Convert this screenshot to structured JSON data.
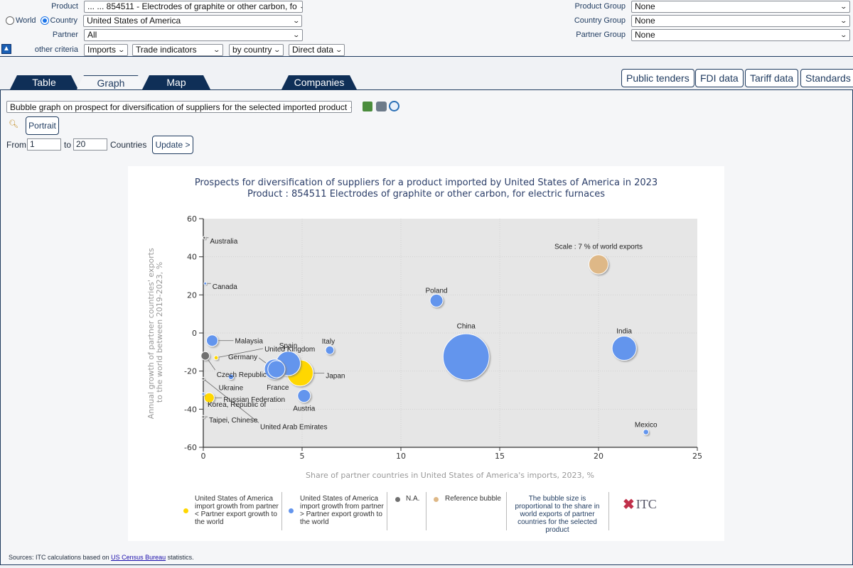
{
  "filters": {
    "product_label": "Product",
    "product_value": "... ... 854511 - Electrodes of graphite or other carbon, fo",
    "world_label": "World",
    "country_label": "Country",
    "reporter_mode": "Country",
    "country_value": "United States of America",
    "partner_label": "Partner",
    "partner_value": "All",
    "other_criteria_label": "other criteria",
    "trade_flow": "Imports",
    "indicator": "Trade indicators",
    "grouping": "by country",
    "data_type": "Direct data",
    "product_group_label": "Product Group",
    "product_group_value": "None",
    "country_group_label": "Country Group",
    "country_group_value": "None",
    "partner_group_label": "Partner Group",
    "partner_group_value": "None"
  },
  "tabs": [
    {
      "label": "Table",
      "active": false
    },
    {
      "label": "Graph",
      "active": true
    },
    {
      "label": "Map",
      "active": false
    },
    {
      "label": "Companies",
      "active": false
    }
  ],
  "right_buttons": [
    "Public tenders",
    "FDI data",
    "Tariff data",
    "Standards"
  ],
  "graph_controls": {
    "graph_type": "Bubble graph on prospect for diversification of suppliers for the selected imported product",
    "portrait_label": "Portrait",
    "from_label": "From",
    "from_value": "1",
    "to_label": "to",
    "to_value": "20",
    "countries_label": "Countries",
    "update_label": "Update >"
  },
  "chart_data": {
    "type": "scatter",
    "subtype": "bubble",
    "title": "Prospects for diversification of suppliers for a product imported by United States of America in 2023",
    "subtitle": "Product : 854511 Electrodes of graphite or other carbon, for electric furnaces",
    "xlabel": "Share of partner countries in United States of America's imports, 2023, %",
    "ylabel": "Annual growth of partner countries' exports to the world between 2019-2023, %",
    "xlim": [
      0,
      25
    ],
    "ylim": [
      -60,
      60
    ],
    "xticks": [
      0,
      5,
      10,
      15,
      20,
      25
    ],
    "yticks": [
      60,
      40,
      20,
      0,
      -20,
      -40,
      -60
    ],
    "grid": true,
    "colors": {
      "lower": "#ffd700",
      "higher": "#6495ed",
      "na": "#707070",
      "reference": "#deb887"
    },
    "points": [
      {
        "name": "Australia",
        "x": 0.05,
        "y": 50,
        "size": 0.1,
        "category": "na"
      },
      {
        "name": "Canada",
        "x": 0.1,
        "y": 26,
        "size": 0.1,
        "category": "higher"
      },
      {
        "name": "Malaysia",
        "x": 0.45,
        "y": -4,
        "size": 2.2,
        "category": "higher"
      },
      {
        "name": "United Kingdom",
        "x": 0.65,
        "y": -13,
        "size": 0.3,
        "category": "lower"
      },
      {
        "name": "Czech Republic",
        "x": 0.1,
        "y": -12,
        "size": 1.2,
        "category": "na"
      },
      {
        "name": "Germany",
        "x": 3.6,
        "y": -19,
        "size": 6.8,
        "category": "higher"
      },
      {
        "name": "France",
        "x": 3.7,
        "y": -19,
        "size": 5.0,
        "category": "higher"
      },
      {
        "name": "Spain",
        "x": 4.3,
        "y": -16,
        "size": 10.0,
        "category": "higher"
      },
      {
        "name": "Japan",
        "x": 4.9,
        "y": -21,
        "size": 11.5,
        "category": "lower"
      },
      {
        "name": "Italy",
        "x": 6.4,
        "y": -9,
        "size": 1.2,
        "category": "higher"
      },
      {
        "name": "Ukraine",
        "x": 1.4,
        "y": -23,
        "size": 0.5,
        "category": "higher"
      },
      {
        "name": "Austria",
        "x": 5.1,
        "y": -33,
        "size": 2.8,
        "category": "higher"
      },
      {
        "name": "Russian Federation",
        "x": 0.3,
        "y": -34,
        "size": 1.7,
        "category": "lower"
      },
      {
        "name": "Korea, Republic of",
        "x": 0.0,
        "y": -32,
        "size": 0.1,
        "category": "higher"
      },
      {
        "name": "United Arab Emirates",
        "x": 0.0,
        "y": -24,
        "size": 0.1,
        "category": "na"
      },
      {
        "name": "Taipei, Chinese",
        "x": 0.0,
        "y": -44,
        "size": 0.1,
        "category": "na"
      },
      {
        "name": "Poland",
        "x": 11.8,
        "y": 17,
        "size": 2.8,
        "category": "higher"
      },
      {
        "name": "China",
        "x": 13.3,
        "y": -12.5,
        "size": 36.0,
        "category": "higher"
      },
      {
        "name": "India",
        "x": 21.3,
        "y": -8,
        "size": 10.0,
        "category": "higher"
      },
      {
        "name": "Mexico",
        "x": 22.4,
        "y": -52,
        "size": 0.5,
        "category": "higher"
      }
    ],
    "reference_bubble": {
      "label": "Scale : 7 % of world exports",
      "x": 20,
      "y": 36,
      "size": 7
    },
    "legend": [
      {
        "text": "United States of America import growth from partner < Partner export growth to the world",
        "color": "#ffd700"
      },
      {
        "text": "United States of America import growth from partner > Partner export growth to the world",
        "color": "#6495ed"
      },
      {
        "text": "N.A.",
        "color": "#707070"
      },
      {
        "text": "Reference bubble",
        "color": "#deb887"
      },
      {
        "text": "The bubble size is proportional to the share in world exports of partner countries for the selected product",
        "color": ""
      }
    ],
    "logo": "ITC"
  },
  "footer": {
    "sources_prefix": "Sources: ITC calculations based on ",
    "sources_link": "US Census Bureau",
    "sources_suffix": " statistics."
  }
}
